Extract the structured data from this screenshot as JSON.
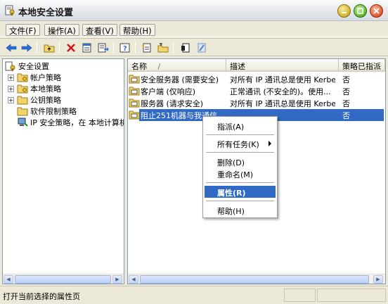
{
  "window": {
    "title": "本地安全设置"
  },
  "menu": [
    "文件(F)",
    "操作(A)",
    "查看(V)",
    "帮助(H)"
  ],
  "tree": {
    "root": "安全设置",
    "items": [
      "帐户策略",
      "本地策略",
      "公钥策略",
      "软件限制策略",
      "IP 安全策略，在 本地计算机"
    ]
  },
  "list": {
    "columns": [
      "名称",
      "描述",
      "策略已指派"
    ],
    "sort_indicator": "/",
    "rows": [
      {
        "name": "安全服务器 (需要安全)",
        "desc": "对所有 IP 通讯总是使用 Kerberos",
        "assigned": "否"
      },
      {
        "name": "客户端 (仅响应)",
        "desc": "正常通讯 (不安全的)。使用...",
        "assigned": "否"
      },
      {
        "name": "服务器 (请求安全)",
        "desc": "对所有 IP 通讯总是使用 Kerberos",
        "assigned": "否"
      },
      {
        "name": "阻止251机器与我通信",
        "desc": "",
        "assigned": "否"
      }
    ]
  },
  "context_menu": {
    "assign": "指派(A)",
    "all_tasks": "所有任务(K)",
    "delete": "删除(D)",
    "rename": "重命名(M)",
    "properties": "属性(R)",
    "help": "帮助(H)"
  },
  "status": {
    "text": "打开当前选择的属性页"
  }
}
